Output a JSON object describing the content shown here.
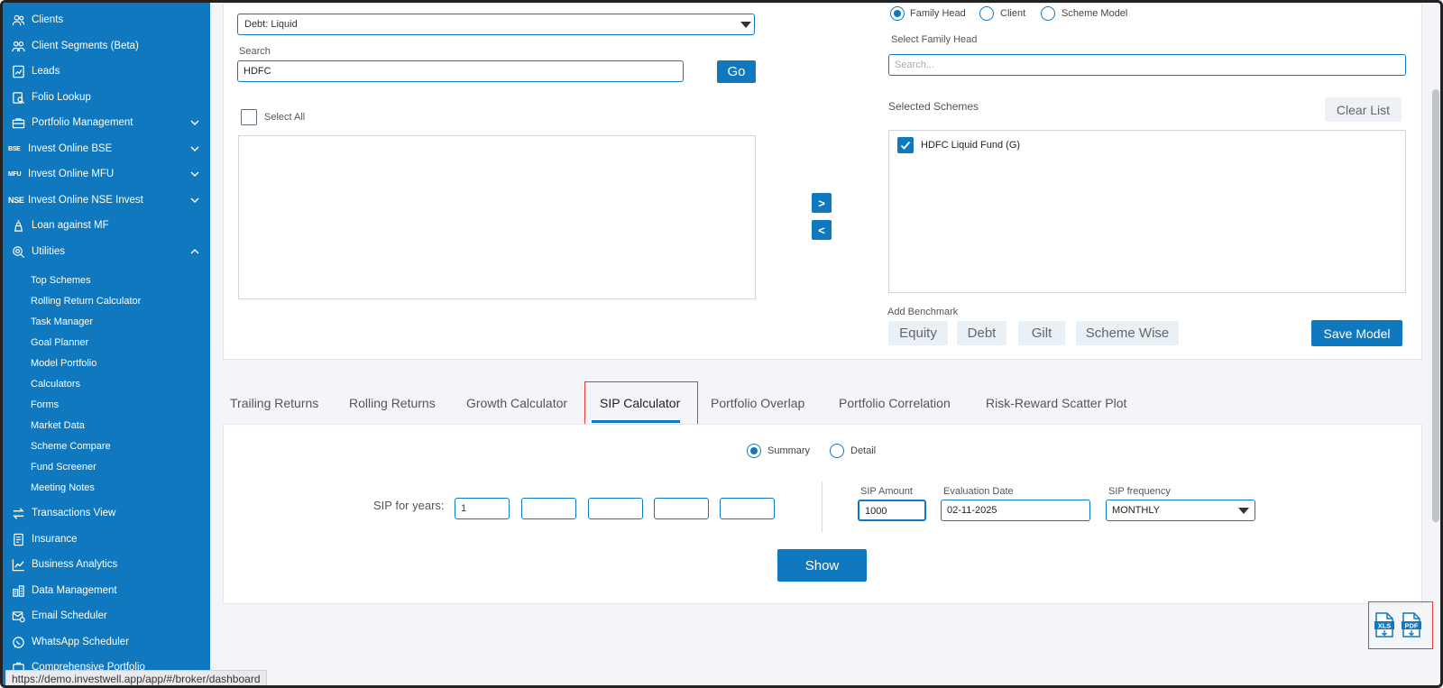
{
  "sidebar": {
    "items": [
      {
        "label": "Clients",
        "icon": "users-icon"
      },
      {
        "label": "Client Segments (Beta)",
        "icon": "segments-icon"
      },
      {
        "label": "Leads",
        "icon": "leads-icon"
      },
      {
        "label": "Folio Lookup",
        "icon": "folio-icon"
      },
      {
        "label": "Portfolio Management",
        "icon": "briefcase-icon"
      },
      {
        "label": "Invest Online BSE",
        "badge": "BSE"
      },
      {
        "label": "Invest Online MFU",
        "badge": "MFU"
      },
      {
        "label": "Invest Online NSE Invest",
        "badge": "NSE"
      },
      {
        "label": "Loan against MF",
        "icon": "loan-icon"
      },
      {
        "label": "Utilities",
        "icon": "utilities-icon"
      }
    ],
    "utilities_sub": [
      "Top Schemes",
      "Rolling Return Calculator",
      "Task Manager",
      "Goal Planner",
      "Model Portfolio",
      "Calculators",
      "Forms",
      "Market Data",
      "Scheme Compare",
      "Fund Screener",
      "Meeting Notes"
    ],
    "items_after": [
      {
        "label": "Transactions View",
        "icon": "transactions-icon"
      },
      {
        "label": "Insurance",
        "icon": "insurance-icon"
      },
      {
        "label": "Business Analytics",
        "icon": "analytics-icon"
      },
      {
        "label": "Data Management",
        "icon": "database-icon"
      },
      {
        "label": "Email Scheduler",
        "icon": "email-icon"
      },
      {
        "label": "WhatsApp Scheduler",
        "icon": "whatsapp-icon"
      },
      {
        "label": "Comprehensive Portfolio",
        "icon": "portfolio-icon"
      }
    ]
  },
  "scheme_panel": {
    "category_value": "Debt: Liquid",
    "search_label": "Search",
    "search_value": "HDFC",
    "go_label": "Go",
    "select_all_label": "Select All",
    "move_right_label": ">",
    "move_left_label": "<"
  },
  "right_panel": {
    "radios": [
      "Family Head",
      "Client",
      "Scheme Model"
    ],
    "selected_radio": "Family Head",
    "select_family_label": "Select Family Head",
    "family_search_placeholder": "Search...",
    "selected_schemes_label": "Selected Schemes",
    "clear_list_label": "Clear List",
    "selected_schemes": [
      "HDFC Liquid Fund (G)"
    ],
    "add_benchmark_label": "Add Benchmark",
    "benchmarks": [
      "Equity",
      "Debt",
      "Gilt",
      "Scheme Wise"
    ],
    "save_model_label": "Save Model"
  },
  "tabs": [
    "Trailing Returns",
    "Rolling Returns",
    "Growth Calculator",
    "SIP Calculator",
    "Portfolio Overlap",
    "Portfolio Correlation",
    "Risk-Reward Scatter Plot"
  ],
  "active_tab": "SIP Calculator",
  "sip": {
    "view_options": [
      "Summary",
      "Detail"
    ],
    "selected_view": "Summary",
    "years_label": "SIP for years:",
    "years_values": [
      "1",
      "",
      "",
      "",
      ""
    ],
    "amount_label": "SIP Amount",
    "amount_value": "1000",
    "eval_date_label": "Evaluation Date",
    "eval_date_value": "02-11-2025",
    "frequency_label": "SIP frequency",
    "frequency_value": "MONTHLY",
    "show_label": "Show"
  },
  "export": {
    "xls_label": "XLS",
    "pdf_label": "PDF"
  },
  "status_url": "https://demo.investwell.app/app/#/broker/dashboard",
  "colors": {
    "primary": "#0f78be",
    "highlight": "#e53935"
  }
}
